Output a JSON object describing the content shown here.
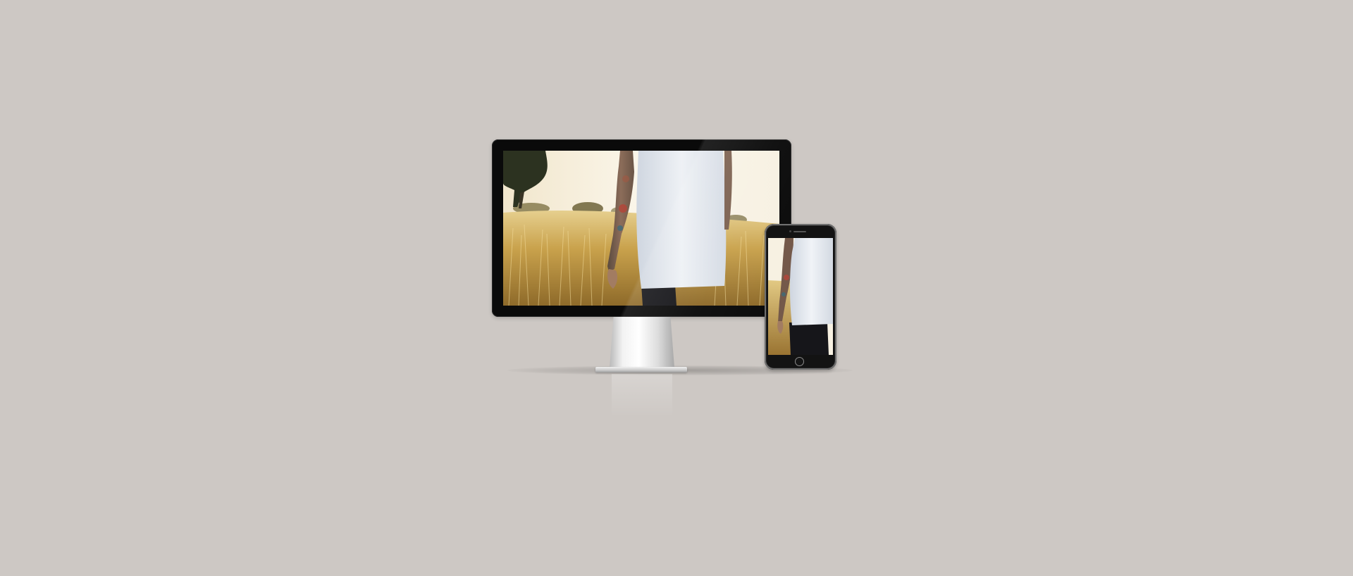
{
  "colors": {
    "background": "#cdc8c4",
    "device_frame": "#0a0a0a",
    "photo_sky": "#f6efdd",
    "photo_grass": "#c8a24a",
    "photo_shirt": "#dfe4ec"
  },
  "devices": {
    "monitor": {
      "type": "desktop-monitor",
      "screen_content": "photo-person-in-wheat-field"
    },
    "phone": {
      "type": "smartphone",
      "screen_content": "photo-person-in-wheat-field"
    }
  }
}
